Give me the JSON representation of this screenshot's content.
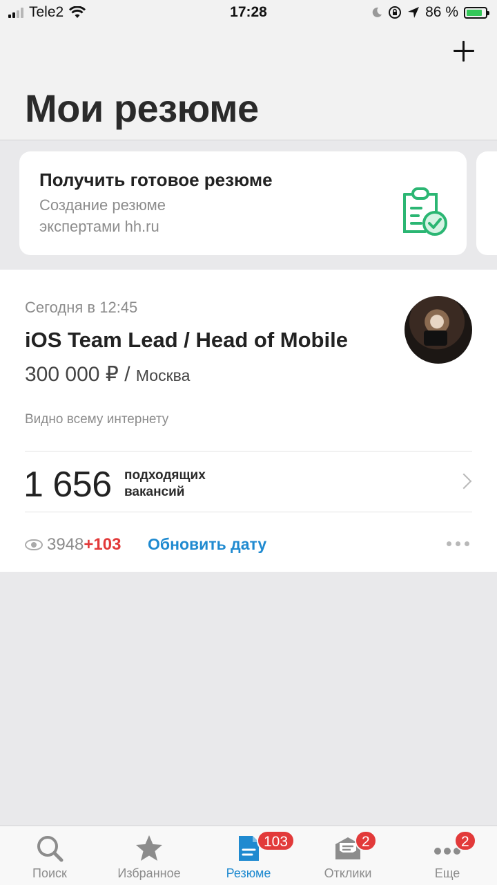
{
  "status_bar": {
    "carrier": "Tele2",
    "time": "17:28",
    "battery_percent": "86 %"
  },
  "header": {
    "title": "Мои резюме",
    "add_icon": "plus-icon"
  },
  "promo": {
    "title": "Получить готовое резюме",
    "subtitle": "Создание резюме экспертами hh.ru",
    "icon": "clipboard-check-icon",
    "accent_color": "#2bb673"
  },
  "resume": {
    "date": "Сегодня в 12:45",
    "title": "iOS Team Lead / Head of Mobile",
    "salary": "300 000 ₽",
    "separator": " / ",
    "city": "Москва",
    "visibility": "Видно всему интернету",
    "vacancies_count": "1 656",
    "vacancies_label_line1": "подходящих",
    "vacancies_label_line2": "вакансий",
    "views": "3948",
    "views_new": "+103",
    "update_label": "Обновить дату"
  },
  "tabbar": {
    "accent_color": "#1f8ad0",
    "badge_color": "#e23a3a",
    "tabs": [
      {
        "label": "Поиск",
        "icon": "search-icon"
      },
      {
        "label": "Избранное",
        "icon": "star-icon"
      },
      {
        "label": "Резюме",
        "icon": "document-icon",
        "badge": "103",
        "active": true
      },
      {
        "label": "Отклики",
        "icon": "envelope-icon",
        "badge": "2"
      },
      {
        "label": "Еще",
        "icon": "more-icon",
        "badge": "2"
      }
    ]
  }
}
